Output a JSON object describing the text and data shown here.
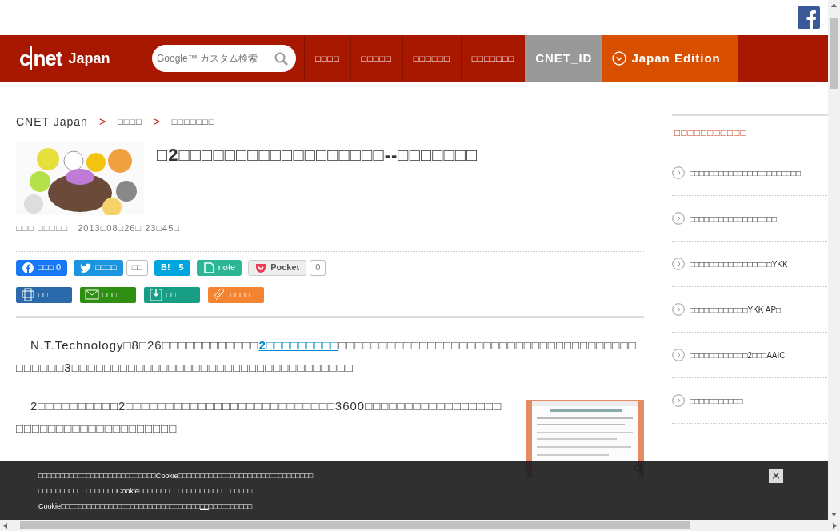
{
  "header": {
    "logo": "cnet",
    "logo_sub": "Japan",
    "search": {
      "placeholder": "Google™ カスタム検索"
    },
    "nav": [
      {
        "label": "□□□□",
        "kind": "menu"
      },
      {
        "label": "□□□□□",
        "kind": "menu"
      },
      {
        "label": "□□□□□□",
        "kind": "menu"
      },
      {
        "label": "□□□□□□□",
        "kind": "menu"
      },
      {
        "label": "CNET_ID",
        "kind": "id"
      },
      {
        "label": "Japan Edition",
        "kind": "edition"
      }
    ]
  },
  "breadcrumb": {
    "separator": ">",
    "items": [
      "CNET Japan",
      "□□□□",
      "□□□□□□□"
    ]
  },
  "article": {
    "title": "□2□□□□□□□□□□□□□□□□□□--□□□□□□□",
    "byline": "□□□ □□□□□",
    "date": "2013□08□26□ 23□45□",
    "share": [
      {
        "kind": "facebook",
        "label": "□□□ 0"
      },
      {
        "kind": "twitter",
        "label": "□□□□",
        "count": "□□"
      },
      {
        "kind": "hatena",
        "label": "B!",
        "count_inline": "5"
      },
      {
        "kind": "note",
        "label": "note"
      },
      {
        "kind": "pocket",
        "label": "Pocket",
        "count": "0"
      }
    ],
    "tools": [
      {
        "kind": "print",
        "label": "□□"
      },
      {
        "kind": "mail",
        "label": "□□□"
      },
      {
        "kind": "save",
        "label": "□□"
      },
      {
        "kind": "clip",
        "label": "□□□□"
      }
    ],
    "paragraphs": [
      {
        "before": "N.T.Technology□8□26□□□□□□□□□□□□",
        "link": "2□□□□□□□□□",
        "after": "□□□□□□□□□□□□□□□□□□□□□□□□□□□□□□□□□□□□□□□□□□□3□□□□□□□□□□□□□□□□□□□□□□□□□□□□□□□□□□□"
      },
      {
        "before": "2□□□□□□□□□□2□□□□□□□□□□□□□□□□□□□□□□□□□□3600□□□□□□□□□□□□□□□□□□□□□□□□□□□□□□□□□□□□□"
      }
    ]
  },
  "sidebar": [
    {
      "title": "□□□□□□□□□□□",
      "items": [
        "□□□□□□□□□□□□□□□□□□□□□□□",
        "□□□□□□□□□□□□□□□□□□",
        "□□□□□□□□□□□□□□□□□YKK",
        "□□□□□□□□□□□□YKK AP□",
        "□□□□□□□□□□□□2□□□AAIC",
        "□□□□□□□□□□□"
      ]
    }
  ],
  "cookie_banner": {
    "lines": [
      {
        "text": "□□□□□□□□□□□□□□□□□□□□□□□□□□□Cookie□□□□□□□□□□□□□□□□□□□□□□□□□□□□□□□"
      },
      {
        "text": "□□□□□□□□□□□□□□□□□□Cookie□□□□□□□□□□□□□□□□□□□□□□□□□□"
      },
      {
        "text": "Cookie□□□□□□□□□□□□□□□□□□□□□□□□□□□□□□□□",
        "link": "□□",
        "after": "□□□□□□□□□□"
      }
    ],
    "close": "×"
  }
}
